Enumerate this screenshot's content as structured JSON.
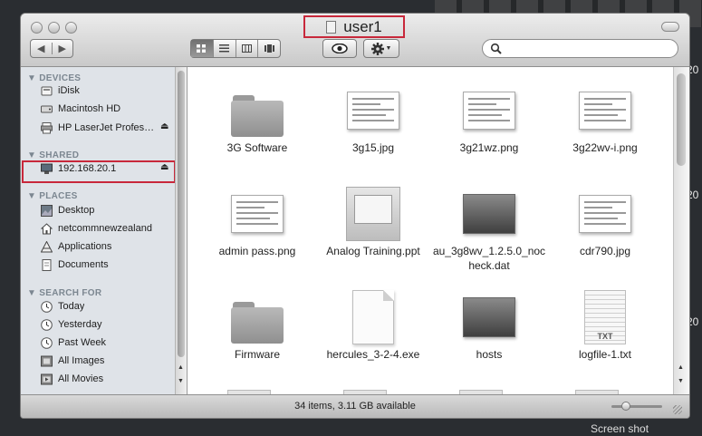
{
  "window": {
    "title": "user1"
  },
  "sidebar": {
    "sections": [
      {
        "heading": "▼ DEVICES",
        "items": [
          {
            "label": "iDisk",
            "icon": "idisk-icon"
          },
          {
            "label": "Macintosh HD",
            "icon": "hard-drive-icon"
          },
          {
            "label": "HP LaserJet Profes…",
            "icon": "printer-icon",
            "eject": "⏏"
          }
        ]
      },
      {
        "heading": "▼ SHARED",
        "items": [
          {
            "label": "192.168.20.1",
            "icon": "network-computer-icon",
            "eject": "⏏",
            "selected": true
          }
        ]
      },
      {
        "heading": "▼ PLACES",
        "items": [
          {
            "label": "Desktop",
            "icon": "desktop-icon"
          },
          {
            "label": "netcommnewzealand",
            "icon": "home-icon"
          },
          {
            "label": "Applications",
            "icon": "applications-icon"
          },
          {
            "label": "Documents",
            "icon": "documents-icon"
          }
        ]
      },
      {
        "heading": "▼ SEARCH FOR",
        "items": [
          {
            "label": "Today",
            "icon": "clock-icon"
          },
          {
            "label": "Yesterday",
            "icon": "clock-icon"
          },
          {
            "label": "Past Week",
            "icon": "clock-icon"
          },
          {
            "label": "All Images",
            "icon": "images-icon"
          },
          {
            "label": "All Movies",
            "icon": "movies-icon"
          }
        ]
      }
    ]
  },
  "files": [
    {
      "name": "3G Software",
      "kind": "folder"
    },
    {
      "name": "3g15.jpg",
      "kind": "screenshot"
    },
    {
      "name": "3g21wz.png",
      "kind": "screenshot"
    },
    {
      "name": "3g22wv-i.png",
      "kind": "screenshot"
    },
    {
      "name": "admin pass.png",
      "kind": "screenshot"
    },
    {
      "name": "Analog Training.ppt",
      "kind": "ppt"
    },
    {
      "name": "au_3g8wv_1.2.5.0_nocheck.dat",
      "kind": "dark"
    },
    {
      "name": "cdr790.jpg",
      "kind": "screenshot"
    },
    {
      "name": "Firmware",
      "kind": "folder"
    },
    {
      "name": "hercules_3-2-4.exe",
      "kind": "doc"
    },
    {
      "name": "hosts",
      "kind": "dark"
    },
    {
      "name": "logfile-1.txt",
      "kind": "txt"
    }
  ],
  "txt_badge": "TXT",
  "status": {
    "text": "34 items, 3.11 GB available"
  },
  "desktop": {
    "right_labels": [
      "20",
      "20",
      "20"
    ],
    "bottom_label": "Screen shot"
  },
  "colors": {
    "highlight": "#c8283b",
    "sidebar_bg": "#dfe3e8"
  }
}
